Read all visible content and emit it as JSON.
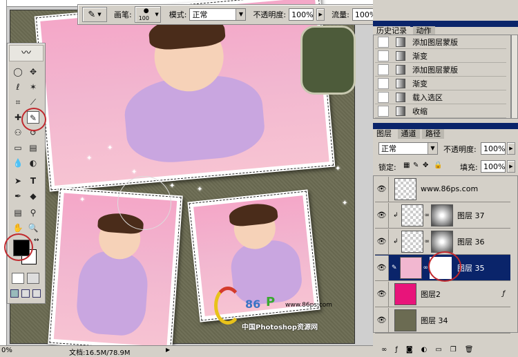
{
  "options_bar": {
    "brush_label": "画笔:",
    "brush_size": "100",
    "mode_label": "模式:",
    "mode_value": "正常",
    "opacity_label": "不透明度:",
    "opacity_value": "100%",
    "flow_label": "流量:",
    "flow_value": "100%"
  },
  "history_panel": {
    "tabs": [
      "历史记录",
      "动作"
    ],
    "items": [
      "添加图层蒙版",
      "渐变",
      "添加图层蒙版",
      "渐变",
      "载入选区",
      "收缩"
    ]
  },
  "layers_panel": {
    "tabs": [
      "图层",
      "通道",
      "路径"
    ],
    "blend_mode": "正常",
    "opacity_label": "不透明度:",
    "opacity_value": "100%",
    "lock_label": "锁定:",
    "fill_label": "填充:",
    "fill_value": "100%",
    "layers": [
      {
        "name": "www.86ps.com",
        "thumb": "checker"
      },
      {
        "name": "图层 37",
        "thumb": "mask"
      },
      {
        "name": "图层 36",
        "thumb": "mask"
      },
      {
        "name": "图层 35",
        "thumb": "mask",
        "selected": true
      },
      {
        "name": "图层2",
        "thumb": "pink"
      },
      {
        "name": "图层 34",
        "thumb": "olive"
      }
    ]
  },
  "status_bar": {
    "zoom": "0%",
    "doc_info": "文档:16.5M/78.9M"
  },
  "watermark": {
    "brand": "86",
    "url": "www.86ps.com",
    "caption": "中国Photoshop资源网"
  },
  "colors": {
    "accent": "#0a246a",
    "highlight_circle": "#c0282d",
    "canvas_bg": "#6b6b52",
    "photo_pink": "#f4a7c8"
  }
}
